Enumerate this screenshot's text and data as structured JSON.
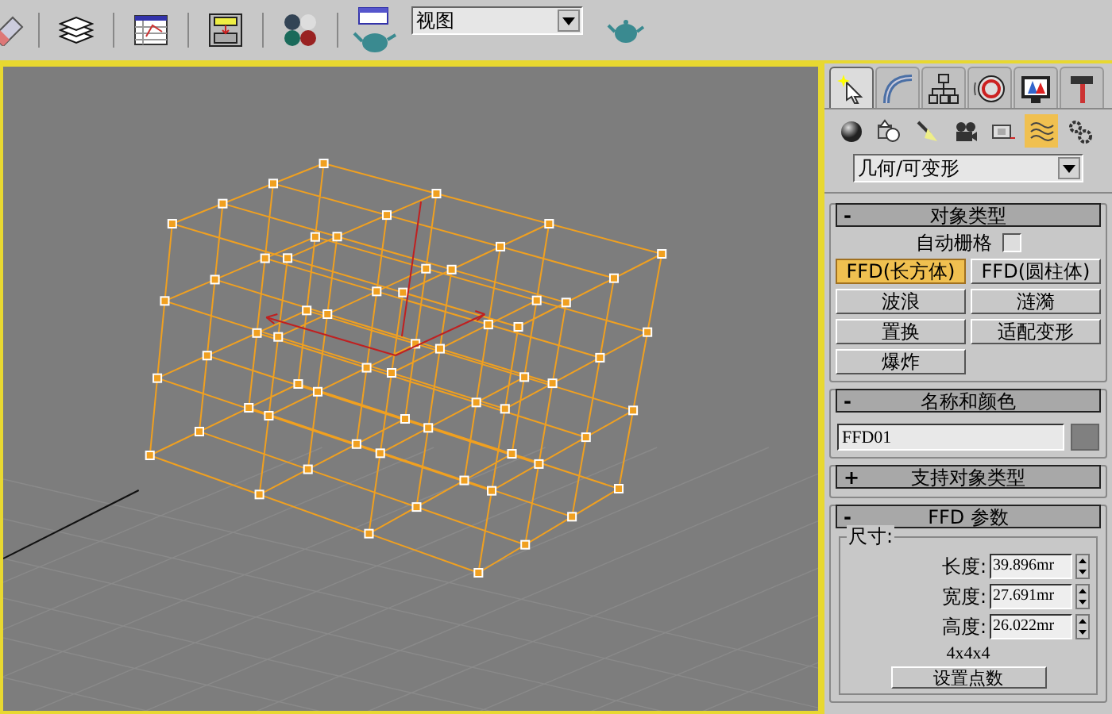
{
  "toolbar": {
    "view_dropdown": {
      "value": "视图"
    }
  },
  "command_panel": {
    "tabs": [
      {
        "kind": "create",
        "selected": true
      },
      {
        "kind": "modify",
        "selected": false
      },
      {
        "kind": "hierarchy",
        "selected": false
      },
      {
        "kind": "motion",
        "selected": false
      },
      {
        "kind": "display",
        "selected": false
      },
      {
        "kind": "utilities",
        "selected": false
      }
    ],
    "categories": [
      {
        "kind": "geometry",
        "selected": false
      },
      {
        "kind": "shapes",
        "selected": false
      },
      {
        "kind": "lights",
        "selected": false
      },
      {
        "kind": "cameras",
        "selected": false
      },
      {
        "kind": "helpers",
        "selected": false
      },
      {
        "kind": "spacewarps",
        "selected": true
      },
      {
        "kind": "systems",
        "selected": false
      }
    ],
    "subcategory_dropdown": {
      "value": "几何/可变形"
    },
    "rollouts": [
      {
        "kind": "object_type",
        "toggle": "-",
        "title": "对象类型",
        "autogrid": {
          "label": "自动栅格",
          "checked": false
        },
        "buttons": [
          {
            "label": "FFD(长方体)",
            "selected": true
          },
          {
            "label": "FFD(圆柱体)",
            "selected": false
          },
          {
            "label": "波浪",
            "selected": false
          },
          {
            "label": "涟漪",
            "selected": false
          },
          {
            "label": "置换",
            "selected": false
          },
          {
            "label": "适配变形",
            "selected": false
          },
          {
            "label": "爆炸",
            "selected": false
          }
        ]
      },
      {
        "kind": "name_color",
        "toggle": "-",
        "title": "名称和颜色",
        "name": "FFD01",
        "color": "#808080"
      },
      {
        "kind": "supports",
        "toggle": "+",
        "title": "支持对象类型"
      },
      {
        "kind": "ffd_params",
        "toggle": "-",
        "title": "FFD 参数",
        "group": "尺寸:",
        "spinners": [
          {
            "label": "长度:",
            "value": "39.896mr"
          },
          {
            "label": "宽度:",
            "value": "27.691mr"
          },
          {
            "label": "高度:",
            "value": "26.022mr"
          }
        ],
        "lattice": "4x4x4",
        "button": "设置点数"
      }
    ]
  }
}
